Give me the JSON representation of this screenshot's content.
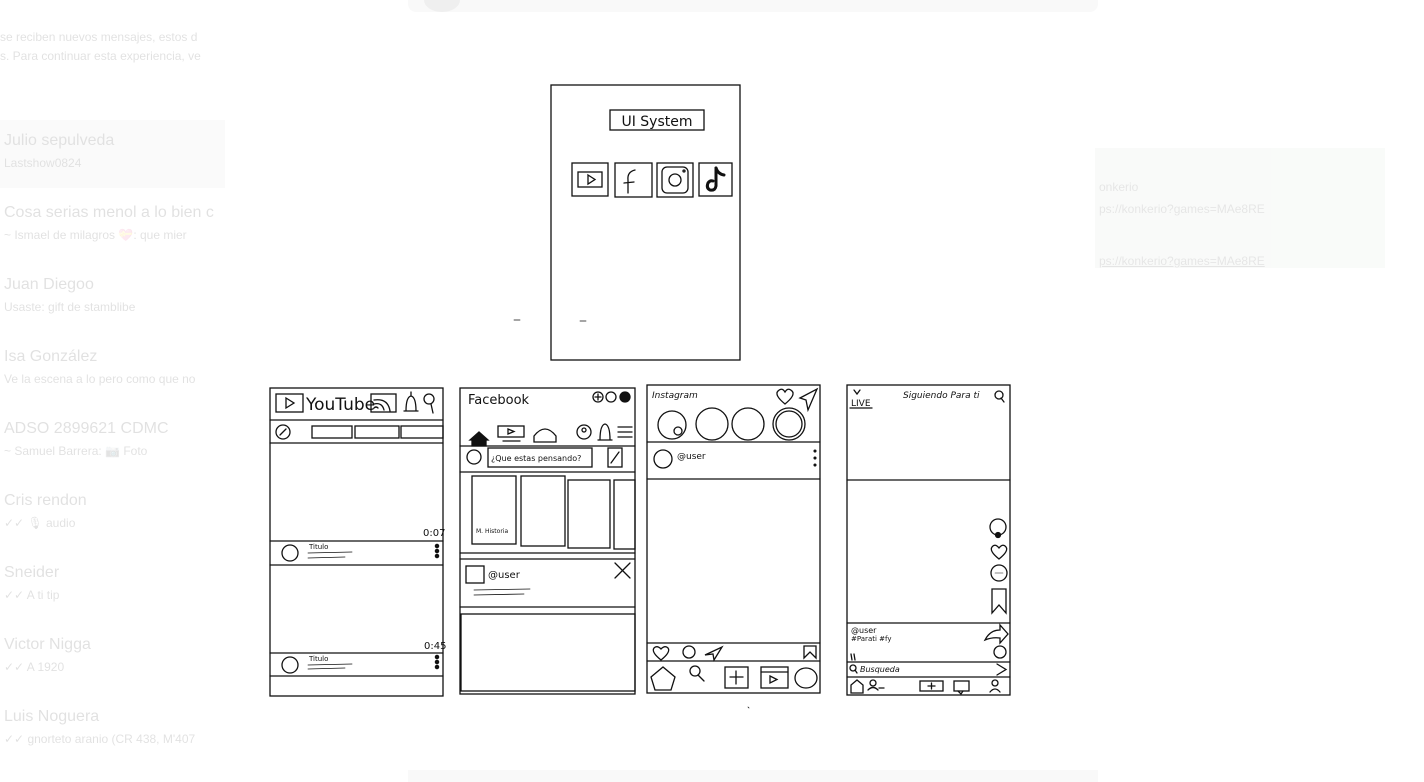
{
  "background_app": {
    "banner_lines": [
      "se reciben nuevos mensajes, estos d",
      "s. Para continuar esta experiencia, ve"
    ],
    "chats": [
      {
        "name": "Julio sepulveda",
        "preview": "Lastshow0824"
      },
      {
        "name": "Cosa serias menol a lo bien c",
        "preview": "~ Ismael de milagros 💝: que mier"
      },
      {
        "name": "Juan Diegoo",
        "preview": "Usaste: gift de stamblibe"
      },
      {
        "name": "Isa González",
        "preview": "Ve la escena a lo pero como que no"
      },
      {
        "name": "ADSO 2899621 CDMC",
        "preview": "~ Samuel Barrera: 📷 Foto"
      },
      {
        "name": "Cris rendon",
        "preview": "✓✓ 🎙 audio"
      },
      {
        "name": "Sneider",
        "preview": "✓✓ A ti tip"
      },
      {
        "name": "Victor Nigga",
        "preview": "✓✓ A 1920"
      },
      {
        "name": "Luis Noguera",
        "preview": "✓✓ gnorteto aranio (CR 438, M'407"
      }
    ],
    "right_panel": {
      "lines": [
        "onkerio",
        "ps://konkerio?games=MAe8RE",
        "ps://konkerio?games=MAe8RE"
      ]
    }
  },
  "sketch": {
    "title_box": "UI System",
    "app_icons": [
      "youtube-icon",
      "facebook-icon",
      "instagram-icon",
      "tiktok-icon"
    ],
    "youtube": {
      "logo": "YouTube",
      "duration_1": "0:07",
      "duration_2": "0:45",
      "video_title_1": "Titulo",
      "video_title_2": "Titulo"
    },
    "facebook": {
      "logo": "Facebook",
      "status_prompt": "¿Que estas pensando?",
      "story_label": "M. Historia",
      "post_user": "@user"
    },
    "instagram": {
      "logo": "Instagram",
      "post_user": "@user"
    },
    "tiktok": {
      "live": "LIVE",
      "tabs": "Siguiendo Para ti",
      "caption_user": "@user",
      "caption_tags": "#Parati #fy",
      "search": "Busqueda"
    }
  }
}
